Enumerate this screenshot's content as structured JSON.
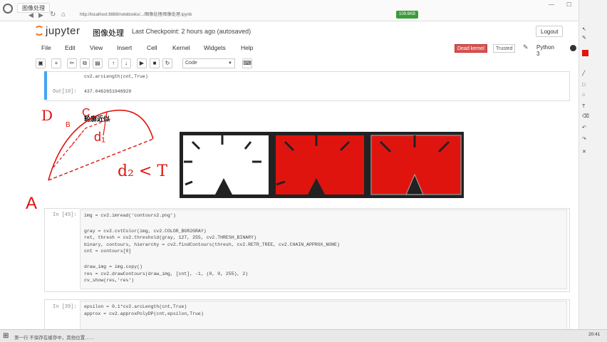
{
  "browser": {
    "tab_title": "图像处理",
    "url": "http://localhost:8888/notebooks/.../图像处理/图像处理.ipynb",
    "status_chip": "109.6KB"
  },
  "header": {
    "logo_text": "jupyter",
    "notebook_title": "图像处理",
    "checkpoint": "Last Checkpoint: 2 hours ago (autosaved)",
    "logout_label": "Logout"
  },
  "menu": {
    "items": [
      "File",
      "Edit",
      "View",
      "Insert",
      "Cell",
      "Kernel",
      "Widgets",
      "Help"
    ],
    "dead_kernel": "Dead kernel",
    "trusted": "Trusted",
    "kernel_name": "Python 3"
  },
  "toolbar": {
    "cell_type": "Code"
  },
  "cells": [
    {
      "prompt": "",
      "lines": [
        "cv2.arcLength(cnt,True)"
      ]
    },
    {
      "prompt": "Out[10]:",
      "lines": [
        "437.0462651948929"
      ]
    },
    {
      "prompt": "",
      "lines": [
        "轮廓近似"
      ]
    },
    {
      "prompt": "In [45]:",
      "lines": [
        "img = cv2.imread('contours2.png')",
        "",
        "gray = cv2.cvtColor(img, cv2.COLOR_BGR2GRAY)",
        "ret, thresh = cv2.threshold(gray, 127, 255, cv2.THRESH_BINARY)",
        "binary, contours, hierarchy = cv2.findContours(thresh, cv2.RETR_TREE, cv2.CHAIN_APPROX_NONE)",
        "cnt = contours[0]",
        "",
        "draw_img = img.copy()",
        "res = cv2.drawContours(draw_img, [cnt], -1, (0, 0, 255), 2)",
        "cv_show(res,'res')"
      ]
    },
    {
      "prompt": "In [39]:",
      "lines": [
        "epsilon = 0.1*cv2.arcLength(cnt,True)",
        "approx = cv2.approxPolyDP(cnt,epsilon,True)"
      ]
    }
  ],
  "annotations": {
    "d1": "d₁",
    "d2_lt_T": "d₂ < T",
    "label_A": "A",
    "label_B": "B",
    "label_C": "C",
    "label_D": "D"
  },
  "taskbar": {
    "status": "第一行 不保存在缓存中，其他位置……",
    "time": "20:41"
  },
  "colors": {
    "red": "#e0140f",
    "dark": "#222222",
    "jupyter_orange": "#f37726",
    "dead_kernel": "#d9534f"
  }
}
